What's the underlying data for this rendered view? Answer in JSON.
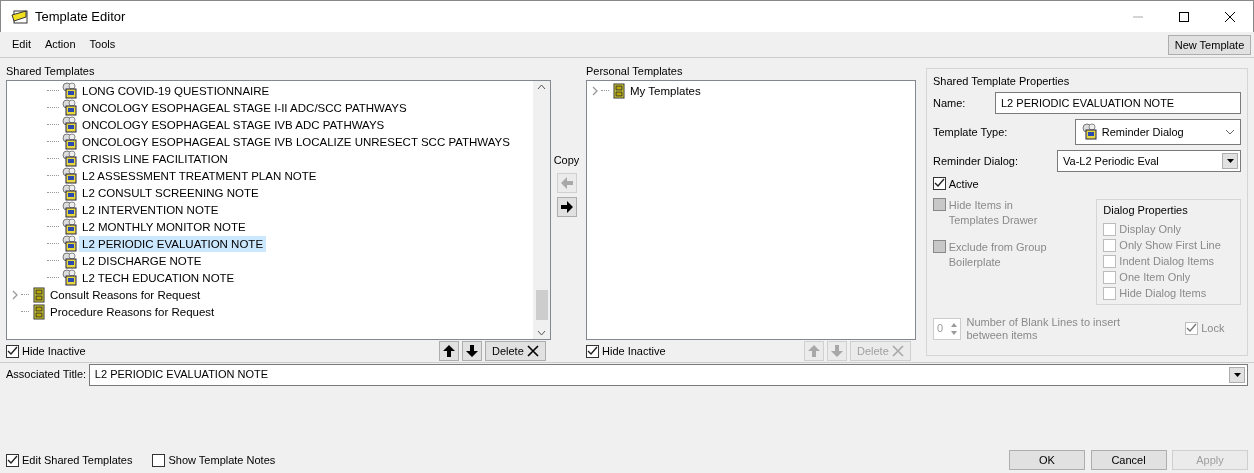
{
  "window": {
    "title": "Template Editor"
  },
  "menu": [
    {
      "label": "Edit"
    },
    {
      "label": "Action"
    },
    {
      "label": "Tools"
    }
  ],
  "new_template_button": "New Template",
  "shared_templates": {
    "label": "Shared Templates",
    "tree": [
      {
        "kind": "group",
        "children": [
          {
            "label": "LONG COVID-19 QUESTIONNAIRE",
            "selected": false
          },
          {
            "label": "ONCOLOGY ESOPHAGEAL STAGE I-II ADC/SCC PATHWAYS",
            "selected": false
          },
          {
            "label": "ONCOLOGY ESOPHAGEAL STAGE IVB ADC PATHWAYS",
            "selected": false
          },
          {
            "label": "ONCOLOGY ESOPHAGEAL STAGE IVB LOCALIZE UNRESECT SCC PATHWAYS",
            "selected": false
          },
          {
            "label": "CRISIS LINE FACILITATION",
            "selected": false
          },
          {
            "label": "L2 ASSESSMENT TREATMENT PLAN NOTE",
            "selected": false
          },
          {
            "label": "L2 CONSULT SCREENING NOTE",
            "selected": false
          },
          {
            "label": "L2 INTERVENTION NOTE",
            "selected": false
          },
          {
            "label": "L2 MONTHLY MONITOR NOTE",
            "selected": false
          },
          {
            "label": "L2 PERIODIC EVALUATION NOTE",
            "selected": true
          },
          {
            "label": "L2 DISCHARGE NOTE",
            "selected": false
          },
          {
            "label": "L2 TECH EDUCATION NOTE",
            "selected": false
          }
        ]
      },
      {
        "kind": "folder",
        "label": "Consult Reasons for Request",
        "expandable": true,
        "selected": false
      },
      {
        "kind": "folder",
        "label": "Procedure Reasons for Request",
        "expandable": false,
        "selected": false
      }
    ],
    "hide_inactive": {
      "label": "Hide Inactive",
      "checked": true
    },
    "move_up_disabled": false,
    "move_down_disabled": false,
    "delete_button": {
      "label": "Delete",
      "disabled": false
    }
  },
  "copy": {
    "label": "Copy",
    "left_disabled": true,
    "right_disabled": false
  },
  "personal_templates": {
    "label": "Personal Templates",
    "tree": [
      {
        "kind": "folder",
        "label": "My Templates",
        "expandable": true,
        "selected": false
      }
    ],
    "hide_inactive": {
      "label": "Hide Inactive",
      "checked": true
    },
    "move_up_disabled": true,
    "move_down_disabled": true,
    "delete_button": {
      "label": "Delete",
      "disabled": true
    }
  },
  "properties": {
    "title": "Shared Template Properties",
    "name_label": "Name:",
    "name_value": "L2 PERIODIC EVALUATION NOTE",
    "type_label": "Template Type:",
    "type_value": "Reminder Dialog",
    "dialog_label": "Reminder Dialog:",
    "dialog_value": "Va-L2 Periodic Eval",
    "left_checks": [
      {
        "label": "Active",
        "checked": true,
        "disabled": false
      },
      {
        "label": "Hide Items in Templates Drawer",
        "checked": false,
        "disabled": true
      },
      {
        "label": "Exclude from Group Boilerplate",
        "checked": false,
        "disabled": true
      }
    ],
    "dialog_properties": {
      "title": "Dialog Properties",
      "items": [
        {
          "label": "Display Only",
          "checked": false,
          "disabled": true
        },
        {
          "label": "Only Show First Line",
          "checked": false,
          "disabled": true
        },
        {
          "label": "Indent Dialog Items",
          "checked": false,
          "disabled": true
        },
        {
          "label": "One Item Only",
          "checked": false,
          "disabled": true
        },
        {
          "label": "Hide Dialog Items",
          "checked": false,
          "disabled": true
        }
      ]
    },
    "blank_lines": {
      "value": "0",
      "label": "Number of Blank Lines to insert between items",
      "disabled": true
    },
    "lock": {
      "label": "Lock",
      "checked": true,
      "disabled": true
    }
  },
  "associated_title": {
    "label": "Associated Title:",
    "value": "L2 PERIODIC EVALUATION NOTE"
  },
  "bottom_checks": [
    {
      "label": "Edit Shared Templates",
      "checked": true
    },
    {
      "label": "Show Template Notes",
      "checked": false
    }
  ],
  "buttons": [
    {
      "label": "OK",
      "disabled": false
    },
    {
      "label": "Cancel",
      "disabled": false
    },
    {
      "label": "Apply",
      "disabled": true
    }
  ]
}
